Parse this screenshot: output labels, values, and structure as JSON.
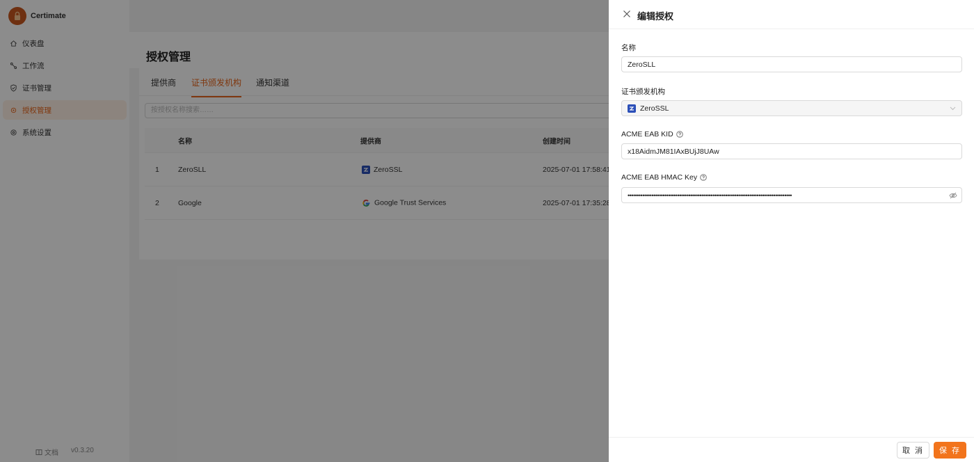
{
  "app": {
    "name": "Certimate"
  },
  "sidebar": {
    "items": [
      {
        "label": "仪表盘",
        "icon": "home-icon"
      },
      {
        "label": "工作流",
        "icon": "workflow-icon"
      },
      {
        "label": "证书管理",
        "icon": "shield-check-icon"
      },
      {
        "label": "授权管理",
        "icon": "key-icon",
        "active": true
      },
      {
        "label": "系统设置",
        "icon": "gear-icon"
      }
    ],
    "footer": {
      "docs": "文档",
      "version": "v0.3.20"
    }
  },
  "page": {
    "title": "授权管理",
    "tabs": [
      {
        "label": "提供商"
      },
      {
        "label": "证书颁发机构",
        "active": true
      },
      {
        "label": "通知渠道"
      }
    ],
    "search": {
      "placeholder": "按授权名称搜索……"
    },
    "table": {
      "columns": [
        "名称",
        "提供商",
        "创建时间"
      ],
      "rows": [
        {
          "index": "1",
          "name": "ZeroSLL",
          "provider": "ZeroSSL",
          "provider_icon": "zerossl-icon",
          "created": "2025-07-01 17:58:41"
        },
        {
          "index": "2",
          "name": "Google",
          "provider": "Google Trust Services",
          "provider_icon": "google-icon",
          "created": "2025-07-01 17:35:28"
        }
      ]
    }
  },
  "drawer": {
    "title": "编辑授权",
    "fields": {
      "name": {
        "label": "名称",
        "value": "ZeroSLL"
      },
      "ca": {
        "label": "证书颁发机构",
        "value": "ZeroSSL"
      },
      "kid": {
        "label": "ACME EAB KID",
        "value": "x18AidmJM81IAxBUjJ8UAw"
      },
      "hmac": {
        "label": "ACME EAB HMAC Key",
        "value": "•••••••••••••••••••••••••••••••••••••••••••••••••••••••••••••••••••••••••••••••••••••••••"
      }
    },
    "buttons": {
      "cancel": "取 消",
      "save": "保 存"
    }
  },
  "colors": {
    "accent": "#f2741c",
    "brand": "#c8581f",
    "zerossl": "#2b4fb8"
  }
}
